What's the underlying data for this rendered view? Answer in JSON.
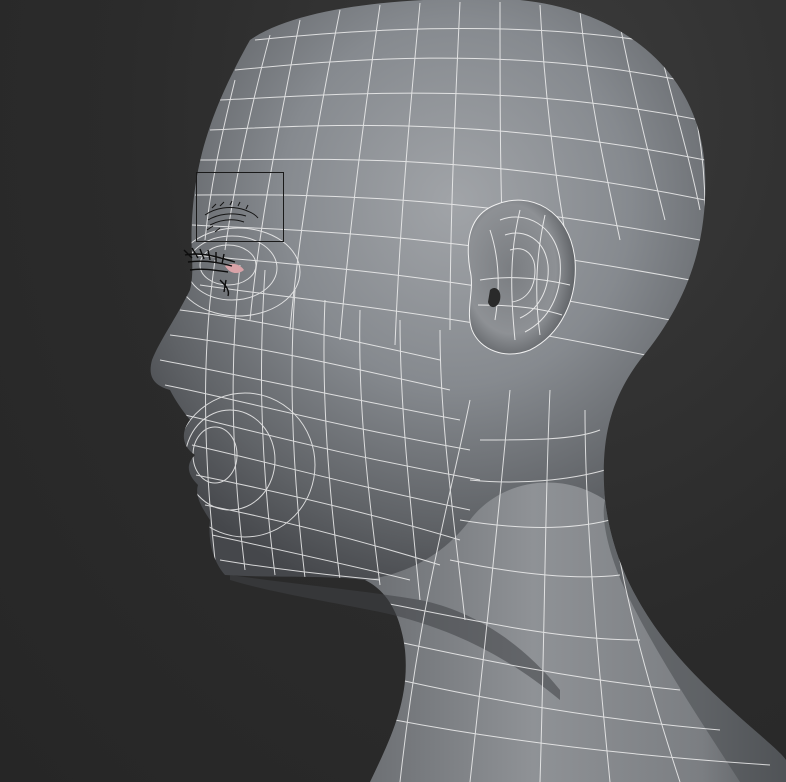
{
  "viewport": {
    "background": "#2e2e2e",
    "mesh_color": "#f2f2f2",
    "skin_light": "#9a9da1",
    "skin_dark": "#4a4c50",
    "eye_accent": "#d9a3a8",
    "lash_color": "#0d0d0d",
    "selection_border": "#1a1a1a"
  },
  "model": {
    "display_mode": "wireframe-on-shaded",
    "view": "left"
  }
}
